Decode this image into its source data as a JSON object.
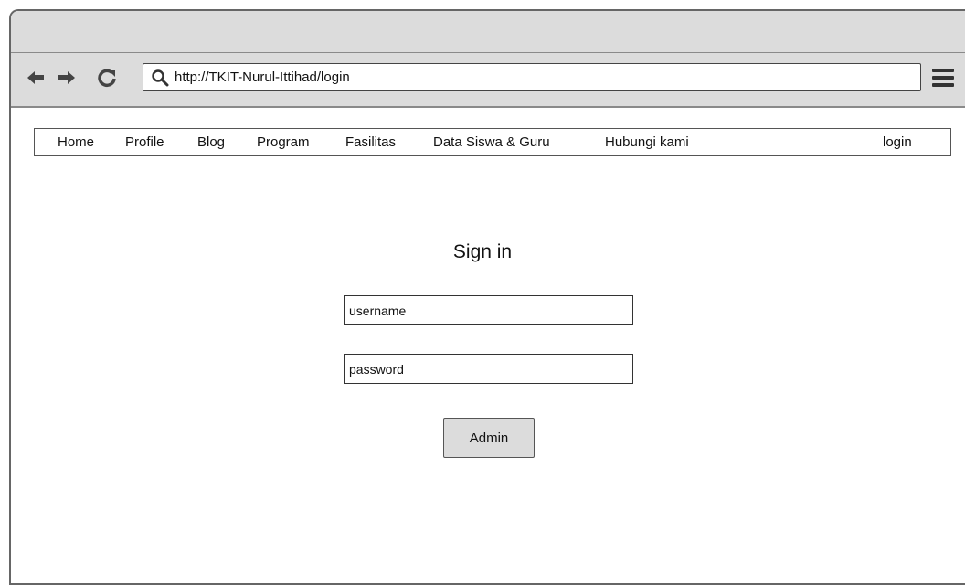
{
  "browser": {
    "url": "http://TKIT-Nurul-Ittihad/login"
  },
  "nav": {
    "items": [
      {
        "label": "Home"
      },
      {
        "label": "Profile"
      },
      {
        "label": "Blog"
      },
      {
        "label": "Program"
      },
      {
        "label": "Fasilitas"
      },
      {
        "label": "Data Siswa & Guru"
      },
      {
        "label": "Hubungi kami"
      }
    ],
    "login_label": "login"
  },
  "signin": {
    "title": "Sign in",
    "username_placeholder": "username",
    "password_placeholder": "password",
    "submit_label": "Admin"
  }
}
